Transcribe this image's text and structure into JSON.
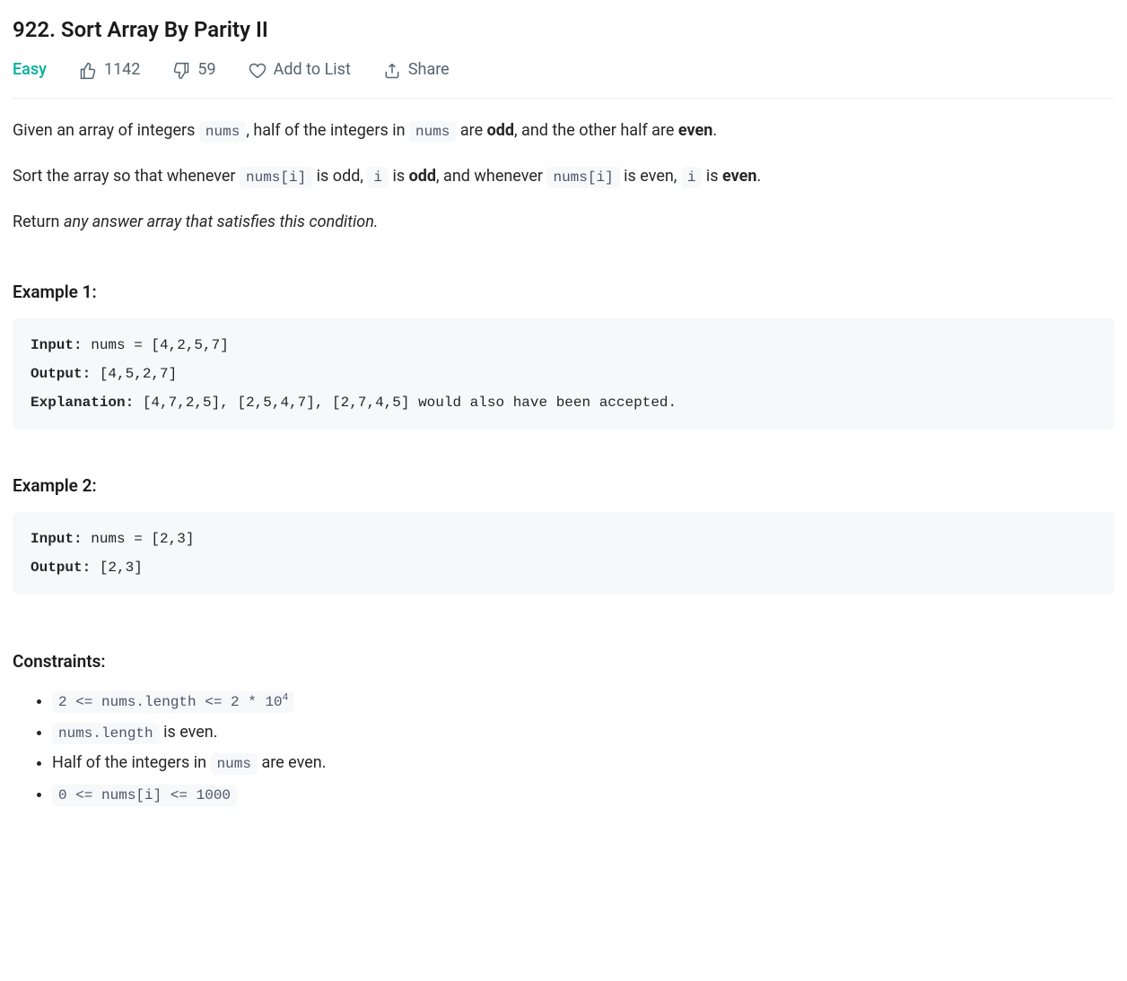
{
  "title": "922. Sort Array By Parity II",
  "meta": {
    "difficulty": "Easy",
    "likes": "1142",
    "dislikes": "59",
    "add_to_list": "Add to List",
    "share": "Share"
  },
  "description": {
    "p1_a": "Given an array of integers ",
    "p1_b": ", half of the integers in ",
    "p1_c": " are ",
    "p1_d": ", and the other half are ",
    "p1_e": ".",
    "nums": "nums",
    "odd": "odd",
    "even": "even",
    "p2_a": "Sort the array so that whenever ",
    "p2_b": " is odd, ",
    "p2_c": " is ",
    "p2_d": ", and whenever ",
    "p2_e": " is even, ",
    "p2_f": " is ",
    "p2_g": ".",
    "nums_i": "nums[i]",
    "i": "i",
    "p3_a": "Return ",
    "p3_b": "any answer array that satisfies this condition."
  },
  "examples": {
    "ex1_heading": "Example 1:",
    "ex1_input_label": "Input:",
    "ex1_input_value": " nums = [4,2,5,7]",
    "ex1_output_label": "Output:",
    "ex1_output_value": " [4,5,2,7]",
    "ex1_explanation_label": "Explanation:",
    "ex1_explanation_value": " [4,7,2,5], [2,5,4,7], [2,7,4,5] would also have been accepted.",
    "ex2_heading": "Example 2:",
    "ex2_input_label": "Input:",
    "ex2_input_value": " nums = [2,3]",
    "ex2_output_label": "Output:",
    "ex2_output_value": " [2,3]"
  },
  "constraints": {
    "heading": "Constraints:",
    "c1_a": "2 <= nums.length <= 2 * 10",
    "c1_sup": "4",
    "c2_code": "nums.length",
    "c2_text": " is even.",
    "c3_a": "Half of the integers in ",
    "c3_code": "nums",
    "c3_b": " are even.",
    "c4": "0 <= nums[i] <= 1000"
  }
}
